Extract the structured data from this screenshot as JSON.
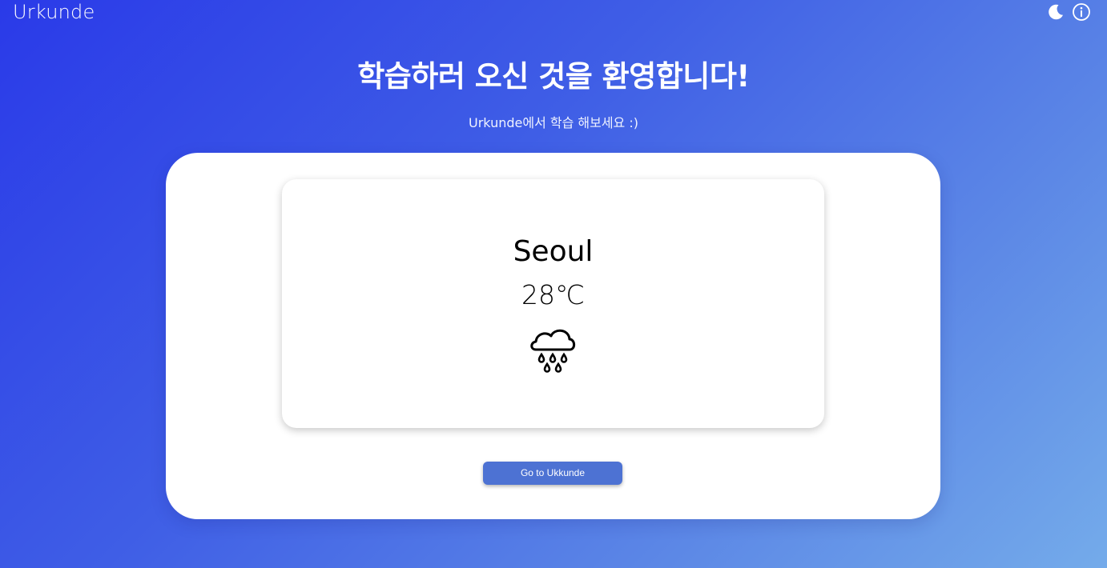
{
  "header": {
    "brand": "Urkunde",
    "icons": [
      "moon-icon",
      "info-icon"
    ]
  },
  "hero": {
    "title": "학습하러 오신 것을 환영합니다!",
    "subtitle": "Urkunde에서 학습 해보세요 :)"
  },
  "weather": {
    "city": "Seoul",
    "temperature": "28℃",
    "condition_icon": "rain-cloud-icon"
  },
  "actions": {
    "go_button_label": "Go to Ukkunde"
  },
  "colors": {
    "gradient_start": "#2a3ae8",
    "gradient_end": "#74abea",
    "button": "#4d72d3",
    "card": "#ffffff"
  }
}
